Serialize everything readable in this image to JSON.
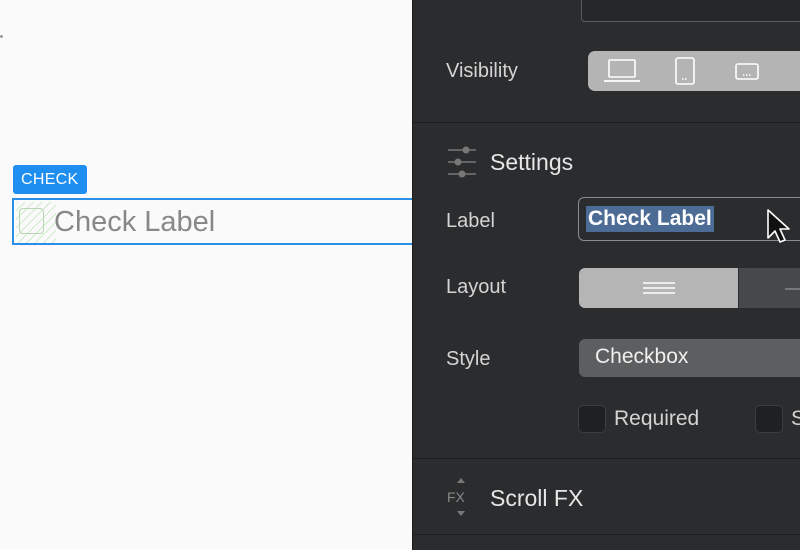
{
  "canvas": {
    "element_tag": "CHECK",
    "checkbox_label": "Check Label"
  },
  "panel": {
    "visibility": {
      "label": "Visibility",
      "devices": [
        "desktop-icon",
        "tablet-icon",
        "mobile-landscape-icon",
        "mobile-portrait-icon"
      ]
    },
    "settings": {
      "title": "Settings",
      "label_field": {
        "label": "Label",
        "value": "Check Label"
      },
      "layout": {
        "label": "Layout",
        "options": [
          "stacked-lines-icon",
          "inline-line-icon"
        ],
        "selected": 0
      },
      "style": {
        "label": "Style",
        "value": "Checkbox"
      },
      "checkboxes": [
        {
          "label": "Required",
          "checked": false
        },
        {
          "label": "S",
          "checked": false
        }
      ]
    },
    "scroll_fx": {
      "title": "Scroll FX"
    }
  },
  "colors": {
    "accent": "#1e8ff0",
    "panel_bg": "#2b2c2e",
    "selection": "#4d6c95"
  }
}
